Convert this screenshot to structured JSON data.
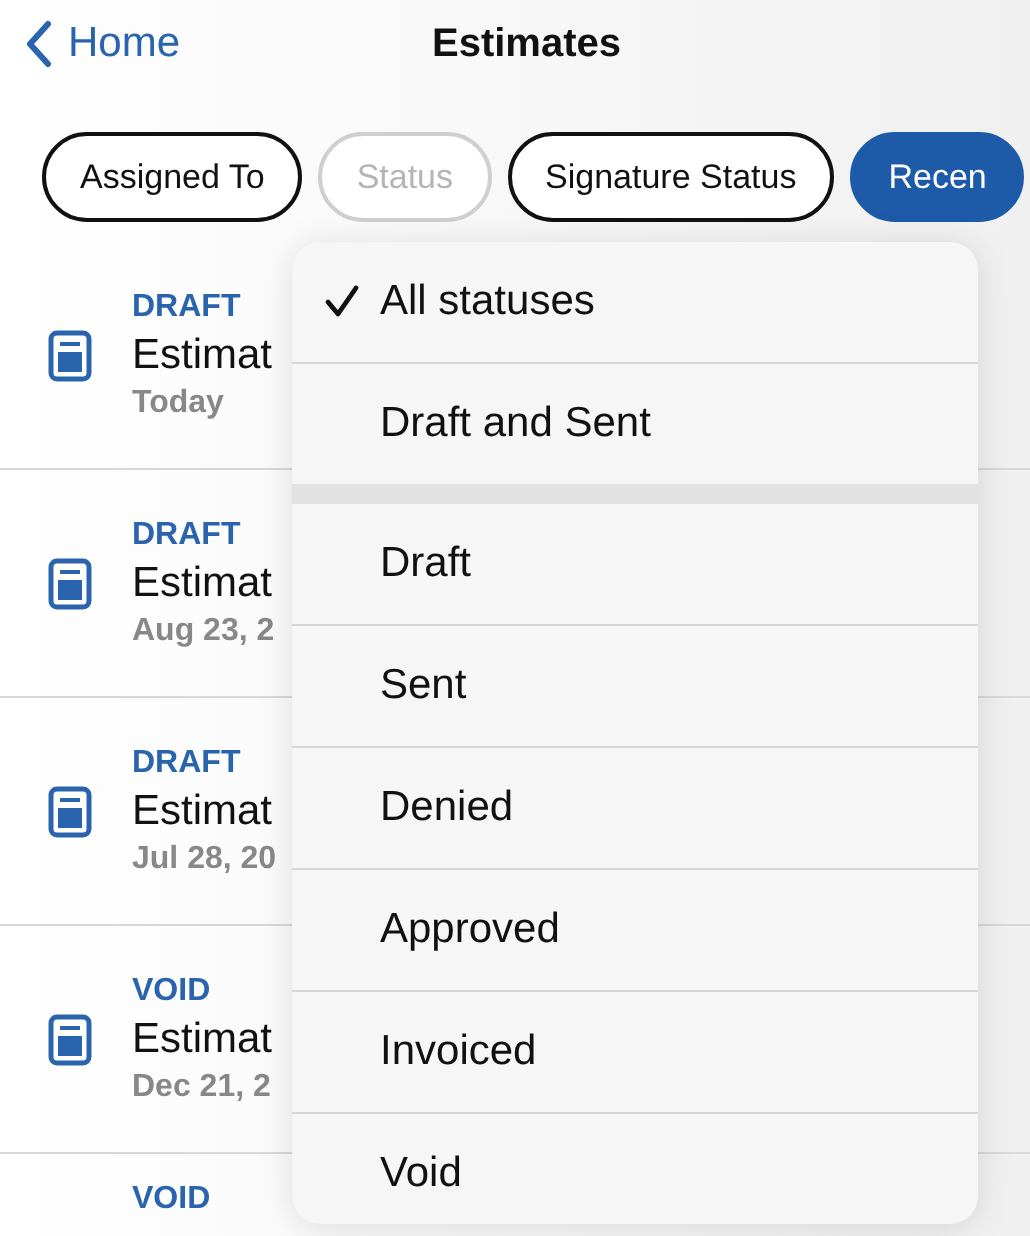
{
  "nav": {
    "back": "Home",
    "title": "Estimates"
  },
  "filters": [
    {
      "label": "Assigned To",
      "kind": "outline",
      "disabled": false
    },
    {
      "label": "Status",
      "kind": "outline",
      "disabled": true
    },
    {
      "label": "Signature Status",
      "kind": "outline",
      "disabled": false
    },
    {
      "label": "Recen",
      "kind": "filled",
      "disabled": false
    }
  ],
  "rows": [
    {
      "status": "DRAFT",
      "title": "Estimat",
      "date": "Today"
    },
    {
      "status": "DRAFT",
      "title": "Estimat",
      "date": "Aug 23, 2"
    },
    {
      "status": "DRAFT",
      "title": "Estimat",
      "date": "Jul 28, 20"
    },
    {
      "status": "VOID",
      "title": "Estimat",
      "date": "Dec 21, 2"
    },
    {
      "status": "VOID"
    }
  ],
  "menu": {
    "groups": [
      [
        {
          "label": "All statuses",
          "selected": true
        },
        {
          "label": "Draft and Sent",
          "selected": false
        }
      ],
      [
        {
          "label": "Draft",
          "selected": false
        },
        {
          "label": "Sent",
          "selected": false
        },
        {
          "label": "Denied",
          "selected": false
        },
        {
          "label": "Approved",
          "selected": false
        },
        {
          "label": "Invoiced",
          "selected": false
        },
        {
          "label": "Void",
          "selected": false
        }
      ]
    ]
  }
}
